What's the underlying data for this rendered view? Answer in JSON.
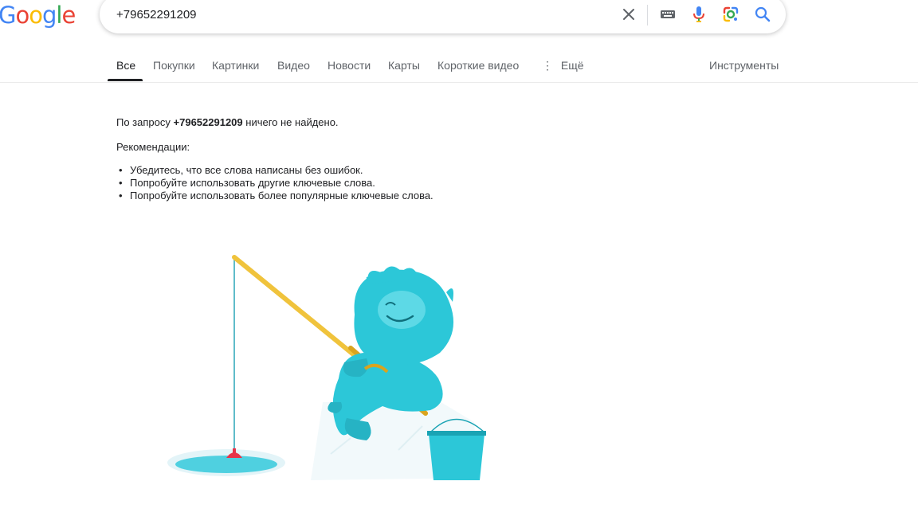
{
  "logo": {
    "text": "Google",
    "colors": [
      "#4285F4",
      "#EA4335",
      "#FBBC05",
      "#4285F4",
      "#34A853",
      "#EA4335"
    ]
  },
  "search": {
    "query": "+79652291209"
  },
  "icons": [
    "close-icon",
    "keyboard-icon",
    "microphone-icon",
    "google-lens-icon",
    "search-icon"
  ],
  "tabs": {
    "items": [
      "Все",
      "Покупки",
      "Картинки",
      "Видео",
      "Новости",
      "Карты",
      "Короткие видео"
    ],
    "more": "Ещё",
    "tools": "Инструменты"
  },
  "results": {
    "prefix": "По запросу",
    "query": "+79652291209",
    "suffix": "ничего не найдено.",
    "recommendations_label": "Рекомендации:",
    "tips": [
      "Убедитесь, что все слова написаны без ошибок.",
      "Попробуйте использовать другие ключевые слова.",
      "Попробуйте использовать более популярные ключевые слова."
    ]
  },
  "colors": {
    "link_blue": "#4285F4",
    "text": "#202124",
    "muted": "#5f6368",
    "creature": "#2cc7d8",
    "rod": "#f2c94c"
  }
}
